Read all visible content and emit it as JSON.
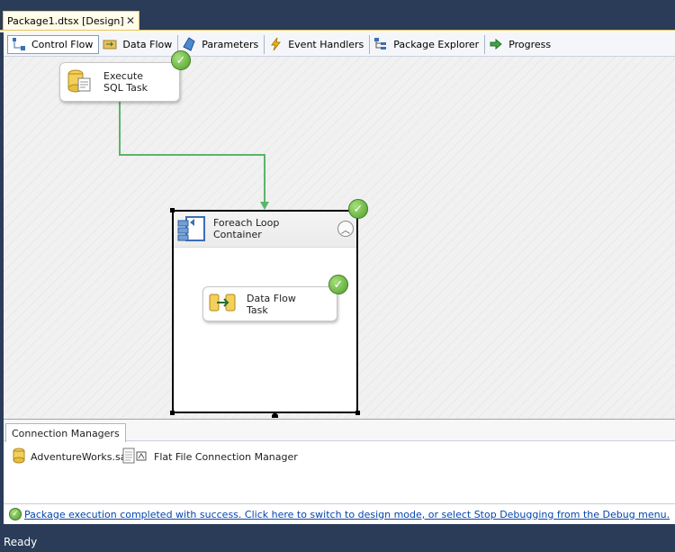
{
  "document_tab": {
    "title": "Package1.dtsx [Design]",
    "close_glyph": "✕"
  },
  "designer_tabs": [
    {
      "label": "Control Flow",
      "icon": "control-flow-icon",
      "active": true
    },
    {
      "label": "Data Flow",
      "icon": "data-flow-icon",
      "active": false
    },
    {
      "label": "Parameters",
      "icon": "parameters-icon",
      "active": false
    },
    {
      "label": "Event Handlers",
      "icon": "event-handlers-icon",
      "active": false
    },
    {
      "label": "Package Explorer",
      "icon": "package-explorer-icon",
      "active": false
    },
    {
      "label": "Progress",
      "icon": "progress-icon",
      "active": false
    }
  ],
  "canvas": {
    "execute_sql_task": {
      "label": "Execute\nSQL Task",
      "icon": "sql-task-icon",
      "status": "success"
    },
    "foreach_container": {
      "label": "Foreach Loop\nContainer",
      "icon": "foreach-loop-icon",
      "status": "success",
      "collapse_glyph": "︿"
    },
    "data_flow_task": {
      "label": "Data Flow\nTask",
      "icon": "data-flow-task-icon",
      "status": "success"
    },
    "check_glyph": "✓"
  },
  "connection_managers": {
    "tab_label": "Connection Managers",
    "items": [
      {
        "label": "AdventureWorks.sa",
        "icon": "database-icon"
      },
      {
        "label": "Flat File Connection Manager",
        "icon": "flat-file-icon"
      }
    ]
  },
  "info_bar": {
    "message": "Package execution completed with success. Click here to switch to design mode, or select Stop Debugging from the Debug menu.",
    "icon": "success-icon"
  },
  "status_bar": {
    "text": "Ready"
  },
  "colors": {
    "chrome": "#2b3c59",
    "success": "#4f9e2a",
    "connector": "#5bb56a",
    "link": "#0645ad"
  }
}
